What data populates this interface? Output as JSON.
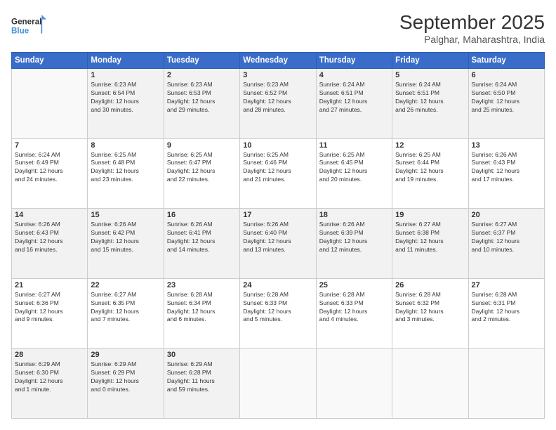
{
  "logo": {
    "line1": "General",
    "line2": "Blue"
  },
  "title": "September 2025",
  "subtitle": "Palghar, Maharashtra, India",
  "days_header": [
    "Sunday",
    "Monday",
    "Tuesday",
    "Wednesday",
    "Thursday",
    "Friday",
    "Saturday"
  ],
  "weeks": [
    [
      {
        "num": "",
        "info": ""
      },
      {
        "num": "1",
        "info": "Sunrise: 6:23 AM\nSunset: 6:54 PM\nDaylight: 12 hours\nand 30 minutes."
      },
      {
        "num": "2",
        "info": "Sunrise: 6:23 AM\nSunset: 6:53 PM\nDaylight: 12 hours\nand 29 minutes."
      },
      {
        "num": "3",
        "info": "Sunrise: 6:23 AM\nSunset: 6:52 PM\nDaylight: 12 hours\nand 28 minutes."
      },
      {
        "num": "4",
        "info": "Sunrise: 6:24 AM\nSunset: 6:51 PM\nDaylight: 12 hours\nand 27 minutes."
      },
      {
        "num": "5",
        "info": "Sunrise: 6:24 AM\nSunset: 6:51 PM\nDaylight: 12 hours\nand 26 minutes."
      },
      {
        "num": "6",
        "info": "Sunrise: 6:24 AM\nSunset: 6:50 PM\nDaylight: 12 hours\nand 25 minutes."
      }
    ],
    [
      {
        "num": "7",
        "info": "Sunrise: 6:24 AM\nSunset: 6:49 PM\nDaylight: 12 hours\nand 24 minutes."
      },
      {
        "num": "8",
        "info": "Sunrise: 6:25 AM\nSunset: 6:48 PM\nDaylight: 12 hours\nand 23 minutes."
      },
      {
        "num": "9",
        "info": "Sunrise: 6:25 AM\nSunset: 6:47 PM\nDaylight: 12 hours\nand 22 minutes."
      },
      {
        "num": "10",
        "info": "Sunrise: 6:25 AM\nSunset: 6:46 PM\nDaylight: 12 hours\nand 21 minutes."
      },
      {
        "num": "11",
        "info": "Sunrise: 6:25 AM\nSunset: 6:45 PM\nDaylight: 12 hours\nand 20 minutes."
      },
      {
        "num": "12",
        "info": "Sunrise: 6:25 AM\nSunset: 6:44 PM\nDaylight: 12 hours\nand 19 minutes."
      },
      {
        "num": "13",
        "info": "Sunrise: 6:26 AM\nSunset: 6:43 PM\nDaylight: 12 hours\nand 17 minutes."
      }
    ],
    [
      {
        "num": "14",
        "info": "Sunrise: 6:26 AM\nSunset: 6:43 PM\nDaylight: 12 hours\nand 16 minutes."
      },
      {
        "num": "15",
        "info": "Sunrise: 6:26 AM\nSunset: 6:42 PM\nDaylight: 12 hours\nand 15 minutes."
      },
      {
        "num": "16",
        "info": "Sunrise: 6:26 AM\nSunset: 6:41 PM\nDaylight: 12 hours\nand 14 minutes."
      },
      {
        "num": "17",
        "info": "Sunrise: 6:26 AM\nSunset: 6:40 PM\nDaylight: 12 hours\nand 13 minutes."
      },
      {
        "num": "18",
        "info": "Sunrise: 6:26 AM\nSunset: 6:39 PM\nDaylight: 12 hours\nand 12 minutes."
      },
      {
        "num": "19",
        "info": "Sunrise: 6:27 AM\nSunset: 6:38 PM\nDaylight: 12 hours\nand 11 minutes."
      },
      {
        "num": "20",
        "info": "Sunrise: 6:27 AM\nSunset: 6:37 PM\nDaylight: 12 hours\nand 10 minutes."
      }
    ],
    [
      {
        "num": "21",
        "info": "Sunrise: 6:27 AM\nSunset: 6:36 PM\nDaylight: 12 hours\nand 9 minutes."
      },
      {
        "num": "22",
        "info": "Sunrise: 6:27 AM\nSunset: 6:35 PM\nDaylight: 12 hours\nand 7 minutes."
      },
      {
        "num": "23",
        "info": "Sunrise: 6:28 AM\nSunset: 6:34 PM\nDaylight: 12 hours\nand 6 minutes."
      },
      {
        "num": "24",
        "info": "Sunrise: 6:28 AM\nSunset: 6:33 PM\nDaylight: 12 hours\nand 5 minutes."
      },
      {
        "num": "25",
        "info": "Sunrise: 6:28 AM\nSunset: 6:33 PM\nDaylight: 12 hours\nand 4 minutes."
      },
      {
        "num": "26",
        "info": "Sunrise: 6:28 AM\nSunset: 6:32 PM\nDaylight: 12 hours\nand 3 minutes."
      },
      {
        "num": "27",
        "info": "Sunrise: 6:28 AM\nSunset: 6:31 PM\nDaylight: 12 hours\nand 2 minutes."
      }
    ],
    [
      {
        "num": "28",
        "info": "Sunrise: 6:29 AM\nSunset: 6:30 PM\nDaylight: 12 hours\nand 1 minute."
      },
      {
        "num": "29",
        "info": "Sunrise: 6:29 AM\nSunset: 6:29 PM\nDaylight: 12 hours\nand 0 minutes."
      },
      {
        "num": "30",
        "info": "Sunrise: 6:29 AM\nSunset: 6:28 PM\nDaylight: 11 hours\nand 59 minutes."
      },
      {
        "num": "",
        "info": ""
      },
      {
        "num": "",
        "info": ""
      },
      {
        "num": "",
        "info": ""
      },
      {
        "num": "",
        "info": ""
      }
    ]
  ]
}
